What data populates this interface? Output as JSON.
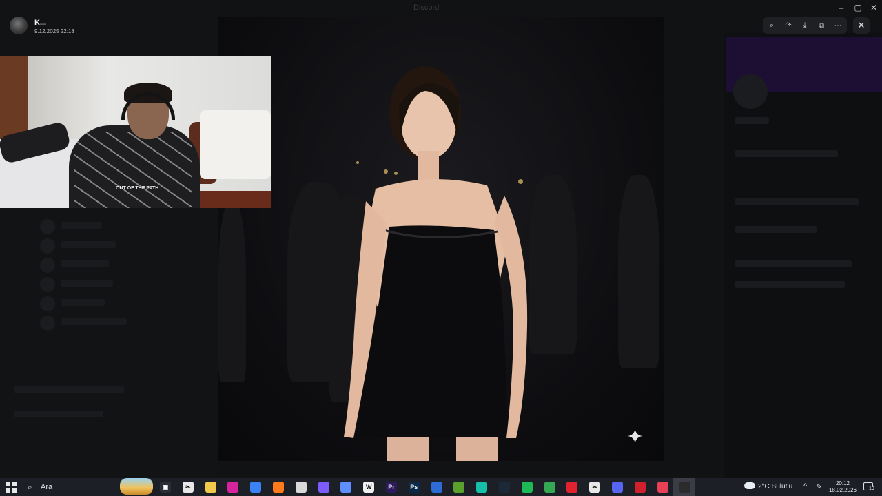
{
  "window": {
    "title": "Discord"
  },
  "sender": {
    "name": "K...",
    "date": "9.12.2025 22:18"
  },
  "viewer_tools": [
    {
      "name": "zoom-icon",
      "glyph": "⌕"
    },
    {
      "name": "forward-icon",
      "glyph": "↷"
    },
    {
      "name": "download-icon",
      "glyph": "⤓"
    },
    {
      "name": "open-external-icon",
      "glyph": "⧉"
    },
    {
      "name": "more-icon",
      "glyph": "⋯"
    }
  ],
  "close_glyph": "✕",
  "image": {
    "sparkle_glyph": "✦"
  },
  "webcam": {
    "shirt_text": "OUT OF THE PATH"
  },
  "taskbar": {
    "search_label": "Ara",
    "apps": [
      {
        "name": "task-view-icon",
        "color": "#2b2e36",
        "glyph": "▣"
      },
      {
        "name": "capcut-icon",
        "color": "#e8e8e8",
        "glyph": "✂"
      },
      {
        "name": "file-explorer-icon",
        "color": "#f2c94c",
        "glyph": ""
      },
      {
        "name": "instagram-icon",
        "color": "#d6249f",
        "glyph": ""
      },
      {
        "name": "editor-icon",
        "color": "#3b82f6",
        "glyph": ""
      },
      {
        "name": "firefox-icon",
        "color": "#ff7a1a",
        "glyph": ""
      },
      {
        "name": "chatgpt-icon",
        "color": "#d9d9d9",
        "glyph": ""
      },
      {
        "name": "proton-icon",
        "color": "#7c5cff",
        "glyph": ""
      },
      {
        "name": "arc-icon",
        "color": "#5f8fff",
        "glyph": ""
      },
      {
        "name": "notion-icon",
        "color": "#f0f0f0",
        "glyph": "W"
      },
      {
        "name": "premiere-icon",
        "color": "#2d1a5c",
        "glyph": "Pr"
      },
      {
        "name": "photoshop-icon",
        "color": "#0b2a4a",
        "glyph": "Ps"
      },
      {
        "name": "generic-app-icon",
        "color": "#2f6bd6",
        "glyph": ""
      },
      {
        "name": "minecraft-icon",
        "color": "#5aa02c",
        "glyph": ""
      },
      {
        "name": "cursor-icon",
        "color": "#16c0a8",
        "glyph": ""
      },
      {
        "name": "steam-icon",
        "color": "#1b2838",
        "glyph": ""
      },
      {
        "name": "spotify-icon",
        "color": "#1db954",
        "glyph": ""
      },
      {
        "name": "chrome-icon",
        "color": "#34a853",
        "glyph": ""
      },
      {
        "name": "opera-icon",
        "color": "#e0232e",
        "glyph": ""
      },
      {
        "name": "capcut-secondary-icon",
        "color": "#e8e8e8",
        "glyph": "✂"
      },
      {
        "name": "discord-icon",
        "color": "#5865f2",
        "glyph": ""
      },
      {
        "name": "red-app-icon",
        "color": "#d11f2b",
        "glyph": ""
      },
      {
        "name": "valorant-icon",
        "color": "#e84057",
        "glyph": ""
      },
      {
        "name": "obs-icon",
        "color": "#2b2b2b",
        "glyph": ""
      }
    ],
    "weather": "2°C  Bulutlu",
    "time": "20:12",
    "date": "18.02.2026",
    "notification_count": "10"
  }
}
